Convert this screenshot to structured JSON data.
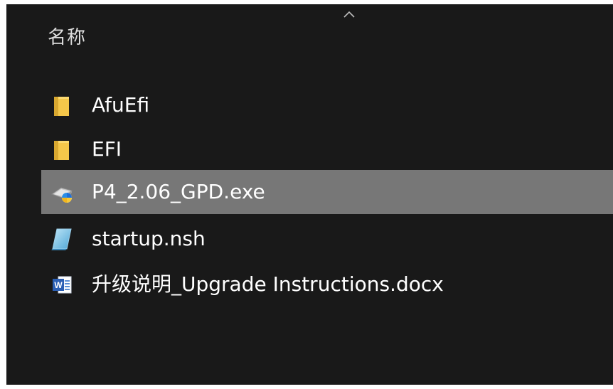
{
  "header": {
    "column_name": "名称",
    "sort_indicator": "chevron-up-icon"
  },
  "files": [
    {
      "name": "AfuEfi",
      "type": "folder",
      "icon": "folder-icon",
      "selected": false
    },
    {
      "name": "EFI",
      "type": "folder",
      "icon": "folder-icon",
      "selected": false
    },
    {
      "name": "P4_2.06_GPD.exe",
      "type": "exe",
      "icon": "installer-exe-icon",
      "selected": true
    },
    {
      "name": "startup.nsh",
      "type": "nsh",
      "icon": "script-file-icon",
      "selected": false
    },
    {
      "name": "升级说明_Upgrade Instructions.docx",
      "type": "docx",
      "icon": "word-doc-icon",
      "selected": false
    }
  ],
  "colors": {
    "background": "#191919",
    "selected_row": "#777777",
    "text": "#ffffff",
    "folder": "#f5c74a"
  }
}
